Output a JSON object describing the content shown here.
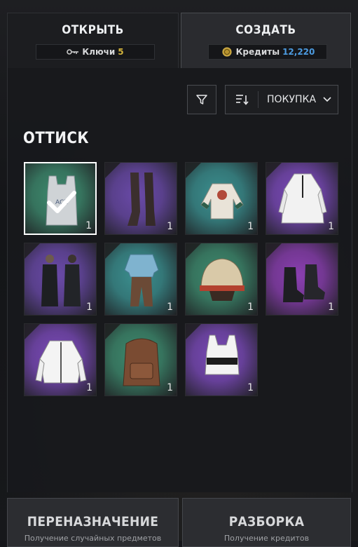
{
  "tabs": [
    {
      "title": "ОТКРЫТЬ",
      "counter_label": "Ключи",
      "counter_value": "5",
      "icon": "key-icon",
      "active": false
    },
    {
      "title": "СОЗДАТЬ",
      "counter_label": "Кредиты",
      "counter_value": "12,220",
      "icon": "credits-coin-icon",
      "active": true
    }
  ],
  "toolbar": {
    "sort_label": "ПОКУПКА",
    "filter_icon": "filter-icon",
    "sort_icon": "sort-icon",
    "dropdown_icon": "chevron-down-icon"
  },
  "section_title": "ОТТИСК",
  "items": [
    {
      "name": "Green tank top",
      "qty": "1",
      "rarity_color": "#3e8a6e",
      "selected": true
    },
    {
      "name": "Thigh-high boots",
      "qty": "1",
      "rarity_color": "#6a4aa8",
      "selected": false
    },
    {
      "name": "Printed long-sleeve shirt",
      "qty": "1",
      "rarity_color": "#3b8f8f",
      "selected": false
    },
    {
      "name": "White long coat",
      "qty": "1",
      "rarity_color": "#7a4ab8",
      "selected": false
    },
    {
      "name": "Dark coat outfit",
      "qty": "1",
      "rarity_color": "#6a4aa8",
      "selected": false
    },
    {
      "name": "Blue shirt and trousers",
      "qty": "1",
      "rarity_color": "#3b8f8f",
      "selected": false
    },
    {
      "name": "Helmet",
      "qty": "1",
      "rarity_color": "#3e8a6e",
      "selected": false
    },
    {
      "name": "Black ankle boots",
      "qty": "1",
      "rarity_color": "#8a3fb0",
      "selected": false
    },
    {
      "name": "White varsity jacket",
      "qty": "1",
      "rarity_color": "#7a4ab8",
      "selected": false
    },
    {
      "name": "Brown backpack",
      "qty": "1",
      "rarity_color": "#3e8a6e",
      "selected": false
    },
    {
      "name": "Crop top",
      "qty": "1",
      "rarity_color": "#7a4ab8",
      "selected": false
    }
  ],
  "bottom": [
    {
      "title": "ПЕРЕНАЗНАЧЕНИЕ",
      "subtitle": "Получение случайных предметов"
    },
    {
      "title": "РАЗБОРКА",
      "subtitle": "Получение кредитов"
    }
  ]
}
